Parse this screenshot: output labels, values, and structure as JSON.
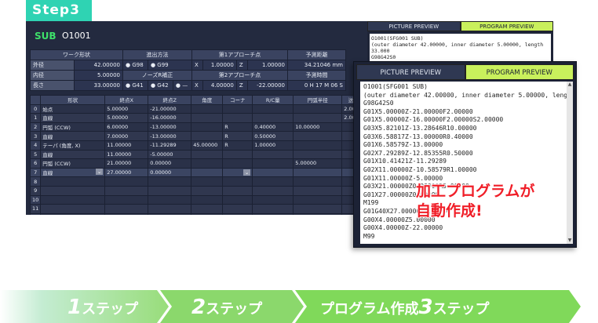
{
  "step_badge": "Step3",
  "screen": {
    "sub_label": "SUB",
    "program_no": "O1001",
    "params": {
      "headers": [
        "ワーク形状",
        "進出方法",
        "第1アプローチ点",
        "予測距離"
      ],
      "rows": [
        {
          "label": "外径",
          "value": "42.00000",
          "opt1": "● G98",
          "opt2": "● G99",
          "ax1": "X",
          "v1": "1.00000",
          "ax2": "Z",
          "v2": "1.00000",
          "pred": "34.21046 mm"
        },
        {
          "label": "内径",
          "value": "5.00000",
          "hdr": "ノーズR補正",
          "hdr2": "第2アプローチ点",
          "hdr3": "予測時間"
        },
        {
          "label": "長さ",
          "value": "33.00000",
          "opt1": "● G41",
          "opt2": "● G42",
          "opt3": "● —",
          "ax1": "X",
          "v1": "4.00000",
          "ax2": "Z",
          "v2": "-22.00000",
          "pred": "0 H 17 M 06 S"
        }
      ]
    },
    "grid": {
      "headers": [
        "",
        "形状",
        "終点X",
        "終点Z",
        "角度",
        "コーナ",
        "R/C量",
        "円弧半径",
        "送り速度",
        "回転数"
      ],
      "rows": [
        [
          "0",
          "始点",
          "5.00000",
          "-21.00000",
          "",
          "",
          "",
          "",
          "2.00000",
          ""
        ],
        [
          "1",
          "直線",
          "5.00000",
          "-16.00000",
          "",
          "",
          "",
          "",
          "2.00000",
          "2"
        ],
        [
          "2",
          "円弧 (CCW)",
          "6.00000",
          "-13.00000",
          "",
          "R",
          "0.40000",
          "10.00000",
          "",
          ""
        ],
        [
          "3",
          "直線",
          "7.00000",
          "-13.00000",
          "",
          "R",
          "0.50000",
          "",
          "",
          ""
        ],
        [
          "4",
          "テーパ (角度, X)",
          "11.00000",
          "-11.29289",
          "45.00000",
          "R",
          "1.00000",
          "",
          "",
          ""
        ],
        [
          "5",
          "直線",
          "11.00000",
          "-5.00000",
          "",
          "",
          "",
          "",
          "",
          ""
        ],
        [
          "6",
          "円弧 (CCW)",
          "21.00000",
          "0.00000",
          "",
          "",
          "",
          "5.00000",
          "",
          ""
        ],
        [
          "7",
          "直線",
          "27.00000",
          "0.00000",
          "",
          "",
          "",
          "",
          "",
          ""
        ],
        [
          "8",
          "",
          "",
          "",
          "",
          "",
          "",
          "",
          "",
          ""
        ],
        [
          "9",
          "",
          "",
          "",
          "",
          "",
          "",
          "",
          "",
          ""
        ],
        [
          "10",
          "",
          "",
          "",
          "",
          "",
          "",
          "",
          "",
          ""
        ],
        [
          "11",
          "",
          "",
          "",
          "",
          "",
          "",
          "",
          "",
          ""
        ],
        [
          "12",
          "",
          "",
          "",
          "",
          "",
          "",
          "",
          "",
          ""
        ]
      ]
    }
  },
  "back_panel": {
    "tabs": [
      "PICTURE PREVIEW",
      "PROGRAM PREVIEW"
    ],
    "code": [
      "O1001(SFG001 SUB)",
      "(outer diameter 42.00000, inner diameter 5.00000, length 33.000",
      "G98G42S0",
      "G01X5.00000Z-21.00000F2.00000"
    ]
  },
  "front_panel": {
    "tabs": [
      "PICTURE PREVIEW",
      "PROGRAM PREVIEW"
    ],
    "code": [
      "O1001(SFG001 SUB)",
      "(outer diameter 42.00000, inner diameter 5.00000, length 33.000(",
      "G98G42S0",
      "G01X5.00000Z-21.00000F2.00000",
      "G01X5.00000Z-16.00000F2.00000S2.00000",
      "G03X5.82101Z-13.28646R10.00000",
      "G03X6.58817Z-13.00000R0.40000",
      "G01X6.58579Z-13.00000",
      "G02X7.29289Z-12.85355R0.50000",
      "G01X10.41421Z-11.29289",
      "G02X11.00000Z-10.58579R1.00000",
      "G01X11.00000Z-5.00000",
      "G03X21.00000Z0.00000R5.00000",
      "G01X27.00000Z0.00000",
      "M199",
      "G01G40X27.00000Z5.00000",
      "G00X4.00000Z5.00000",
      "G00X4.00000Z-22.00000",
      "M99"
    ]
  },
  "callout": [
    "加工プログラムが",
    "自動作成!"
  ],
  "steps": [
    {
      "num": "1",
      "text": "ステップ"
    },
    {
      "num": "2",
      "text": "ステップ"
    },
    {
      "pre": "プログラム作成",
      "num": "3",
      "text": "ステップ"
    }
  ],
  "colors": {
    "accent_green": "#2fd3b3",
    "tab_active": "#c9f05c",
    "callout_red": "#f01e28",
    "sub_green": "#3ee06a"
  }
}
